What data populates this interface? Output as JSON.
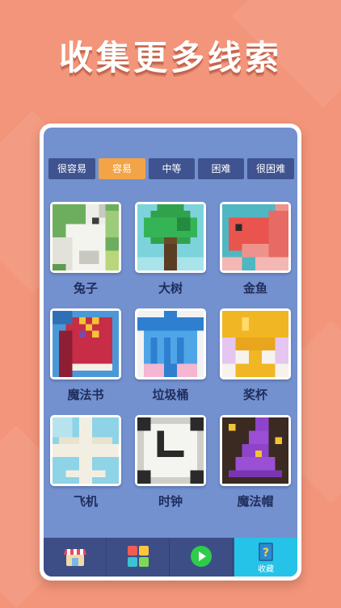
{
  "headline": "收集更多线索",
  "tabs": [
    {
      "label": "很容易",
      "active": false
    },
    {
      "label": "容易",
      "active": true
    },
    {
      "label": "中等",
      "active": false
    },
    {
      "label": "困难",
      "active": false
    },
    {
      "label": "很困难",
      "active": false
    }
  ],
  "puzzles": [
    {
      "label": "兔子",
      "icon": "rabbit-pixel-art"
    },
    {
      "label": "大树",
      "icon": "tree-pixel-art"
    },
    {
      "label": "金鱼",
      "icon": "goldfish-pixel-art"
    },
    {
      "label": "魔法书",
      "icon": "magic-book-pixel-art"
    },
    {
      "label": "垃圾桶",
      "icon": "trash-can-pixel-art"
    },
    {
      "label": "奖杯",
      "icon": "trophy-pixel-art"
    },
    {
      "label": "飞机",
      "icon": "airplane-pixel-art"
    },
    {
      "label": "时钟",
      "icon": "clock-pixel-art"
    },
    {
      "label": "魔法帽",
      "icon": "wizard-hat-pixel-art"
    }
  ],
  "bottom_nav": [
    {
      "icon": "shop-icon",
      "label": ""
    },
    {
      "icon": "puzzle-icon",
      "label": ""
    },
    {
      "icon": "play-icon",
      "label": ""
    },
    {
      "icon": "book-question-icon",
      "label": "收藏",
      "active": true
    }
  ],
  "colors": {
    "accent": "#F2A447",
    "panel": "#7390CF",
    "tab": "#3E538F",
    "nav_active": "#25C3E8"
  }
}
